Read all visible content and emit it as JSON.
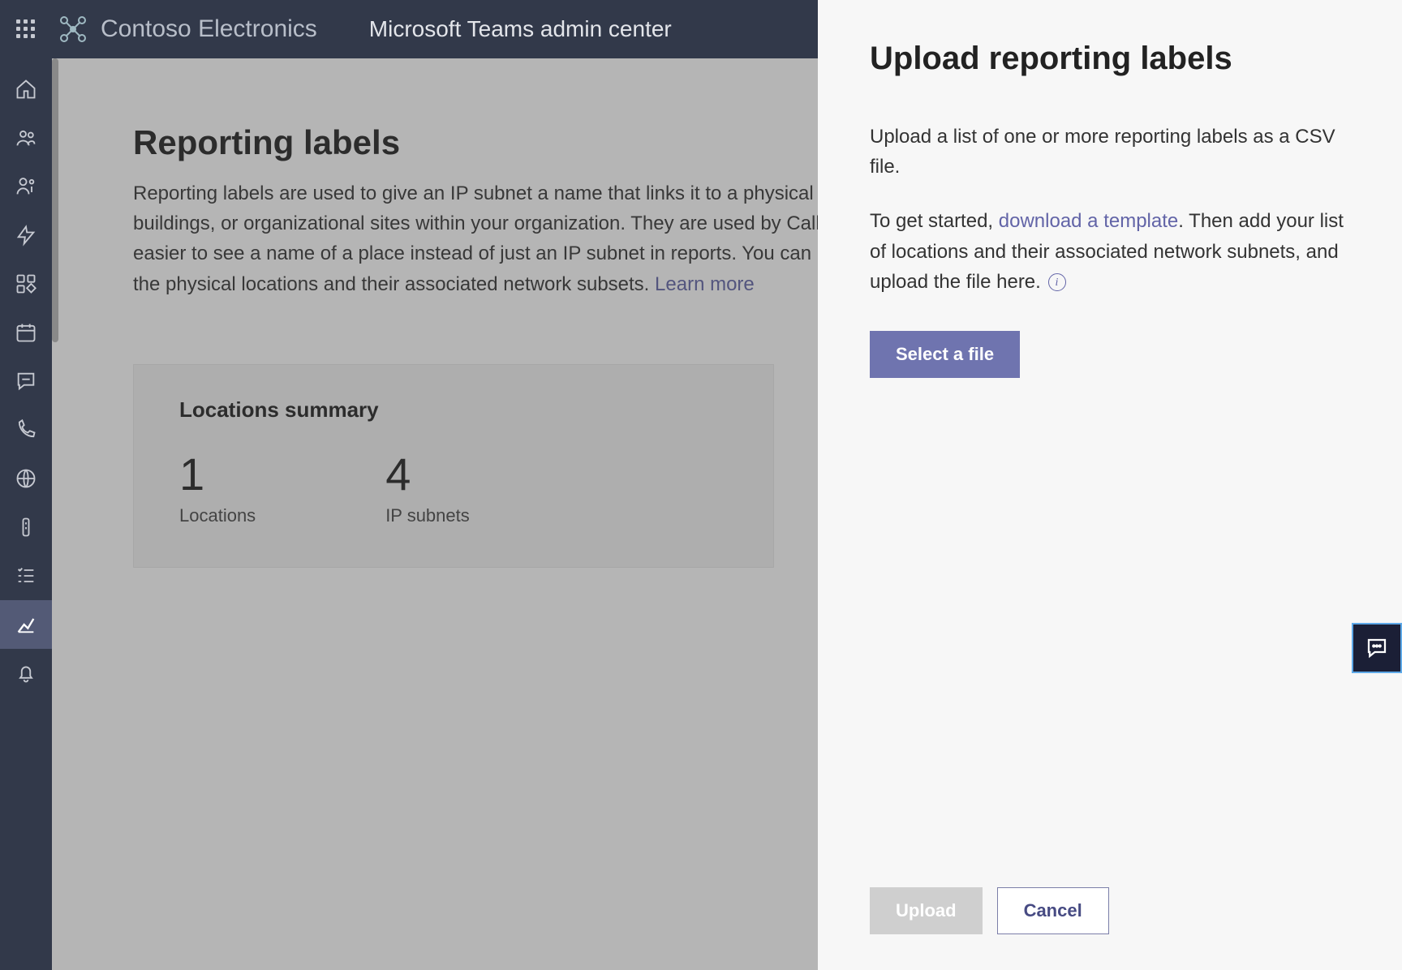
{
  "header": {
    "org_name": "Contoso Electronics",
    "app_name": "Microsoft Teams admin center"
  },
  "page": {
    "title": "Reporting labels",
    "description_prefix": "Reporting labels are used to give an IP subnet a name that links it to a physical location such as offices, buildings, or organizational sites within your organization. They are used by Call Quality Dashboard to make it easier to see a name of a place instead of just an IP subnet in reports. You can upload a single text file that lists the physical locations and their associated network subsets. ",
    "learn_more": "Learn more"
  },
  "summary": {
    "title": "Locations summary",
    "metrics": [
      {
        "value": "1",
        "label": "Locations"
      },
      {
        "value": "4",
        "label": "IP subnets"
      }
    ]
  },
  "panel": {
    "title": "Upload reporting labels",
    "para1": "Upload a list of one or more reporting labels as a CSV file.",
    "para2_prefix": "To get started, ",
    "download_link": "download a template",
    "para2_suffix": ". Then add your list of locations and their associated network subnets, and upload the file here. ",
    "select_button": "Select a file",
    "upload_button": "Upload",
    "cancel_button": "Cancel"
  }
}
